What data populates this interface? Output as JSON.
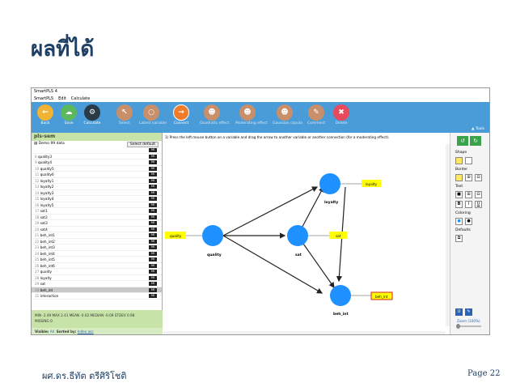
{
  "slide": {
    "title": "ผลที่ได้",
    "author": "ผศ.ดร.ธีทัต ตรีศิริโชติ",
    "page": "Page 22"
  },
  "app": {
    "window_title": "SmartPLS 4",
    "menu": [
      "SmartPLS",
      "Edit",
      "Calculate"
    ],
    "ribbon": [
      {
        "label": "Back",
        "icon": "arrow-left-icon",
        "color": "#f2b233"
      },
      {
        "label": "Save",
        "icon": "cloud-save-icon",
        "color": "#5cb85c"
      },
      {
        "label": "Calculate",
        "icon": "gear-icon",
        "color": "#2b3a47"
      },
      {
        "label": "Select",
        "icon": "cursor-icon",
        "color": "#c98f6a"
      },
      {
        "label": "Latent variable",
        "icon": "circle-icon",
        "color": "#c98f6a"
      },
      {
        "label": "Connect",
        "icon": "arrow-right-icon",
        "color": "#f07b2b"
      },
      {
        "label": "Quadratic effect",
        "icon": "person-icon",
        "color": "#c98f6a"
      },
      {
        "label": "Moderating effect",
        "icon": "person-icon",
        "color": "#c98f6a"
      },
      {
        "label": "Gaussian copula",
        "icon": "group-icon",
        "color": "#c98f6a"
      },
      {
        "label": "Comment",
        "icon": "comment-icon",
        "color": "#c98f6a"
      },
      {
        "label": "Delete",
        "icon": "trash-icon",
        "color": "#e8495c"
      }
    ],
    "tools_label": "Tools"
  },
  "left_panel": {
    "header": "pls-sem",
    "dataset": "Demo 99 data",
    "select_default": "Select default",
    "rows": [
      {
        "num": "",
        "name": "",
        "tag": "MI"
      },
      {
        "num": "8",
        "name": "quality3",
        "tag": "MI"
      },
      {
        "num": "9",
        "name": "quality4",
        "tag": "MI"
      },
      {
        "num": "10",
        "name": "quality5",
        "tag": "MI"
      },
      {
        "num": "11",
        "name": "quality6",
        "tag": "MI"
      },
      {
        "num": "12",
        "name": "loyalty1",
        "tag": "MI"
      },
      {
        "num": "13",
        "name": "loyalty2",
        "tag": "MI"
      },
      {
        "num": "14",
        "name": "loyalty3",
        "tag": "MI"
      },
      {
        "num": "15",
        "name": "loyalty4",
        "tag": "MI"
      },
      {
        "num": "16",
        "name": "loyalty5",
        "tag": "MI"
      },
      {
        "num": "17",
        "name": "sat1",
        "tag": "MI"
      },
      {
        "num": "18",
        "name": "sat2",
        "tag": "MI"
      },
      {
        "num": "19",
        "name": "sat3",
        "tag": "MI"
      },
      {
        "num": "20",
        "name": "sat4",
        "tag": "MI"
      },
      {
        "num": "21",
        "name": "beh_int1",
        "tag": "MI"
      },
      {
        "num": "22",
        "name": "beh_int2",
        "tag": "MI"
      },
      {
        "num": "23",
        "name": "beh_int3",
        "tag": "MI"
      },
      {
        "num": "24",
        "name": "beh_int4",
        "tag": "MI"
      },
      {
        "num": "25",
        "name": "beh_int5",
        "tag": "MI"
      },
      {
        "num": "26",
        "name": "beh_int6",
        "tag": "MI"
      },
      {
        "num": "27",
        "name": "quality",
        "tag": "MI"
      },
      {
        "num": "28",
        "name": "loyalty",
        "tag": "MI"
      },
      {
        "num": "29",
        "name": "sat",
        "tag": "MI"
      },
      {
        "num": "30",
        "name": "beh_int",
        "tag": "MI"
      },
      {
        "num": "31",
        "name": "interaction",
        "tag": "MI"
      }
    ],
    "highlighted_row": 23,
    "stats_line1": "MIN -2.49   MAX 2.41   MEAN -0.02   MEDIAN -0.09   STDEV 0.98",
    "stats_line2": "MISSING 0",
    "visible_label": "Visible:",
    "visible_value": "All",
    "sorted_label": "Sorted by:",
    "sorted_value": "Index asc"
  },
  "canvas": {
    "instruction": "1) Press the left mouse button on a variable and drag the arrow to another variable or another connection (for a moderating effect).",
    "nodes": {
      "quality": "quality",
      "loyalty": "loyalty",
      "sat": "sat",
      "beh_int": "beh_int"
    },
    "indicators": {
      "quality": "quality",
      "loyalty": "loyalty",
      "sat": "sat",
      "beh_int": "beh_int"
    },
    "node_color": "#1e90ff",
    "indicator_color": "#ffff00"
  },
  "right_panel": {
    "shape": "Shape",
    "border": "Border",
    "text": "Text",
    "coloring": "Coloring",
    "defaults": "Defaults",
    "text_buttons": [
      "B",
      "I",
      "U"
    ],
    "zoom": "Zoom (100%)"
  }
}
